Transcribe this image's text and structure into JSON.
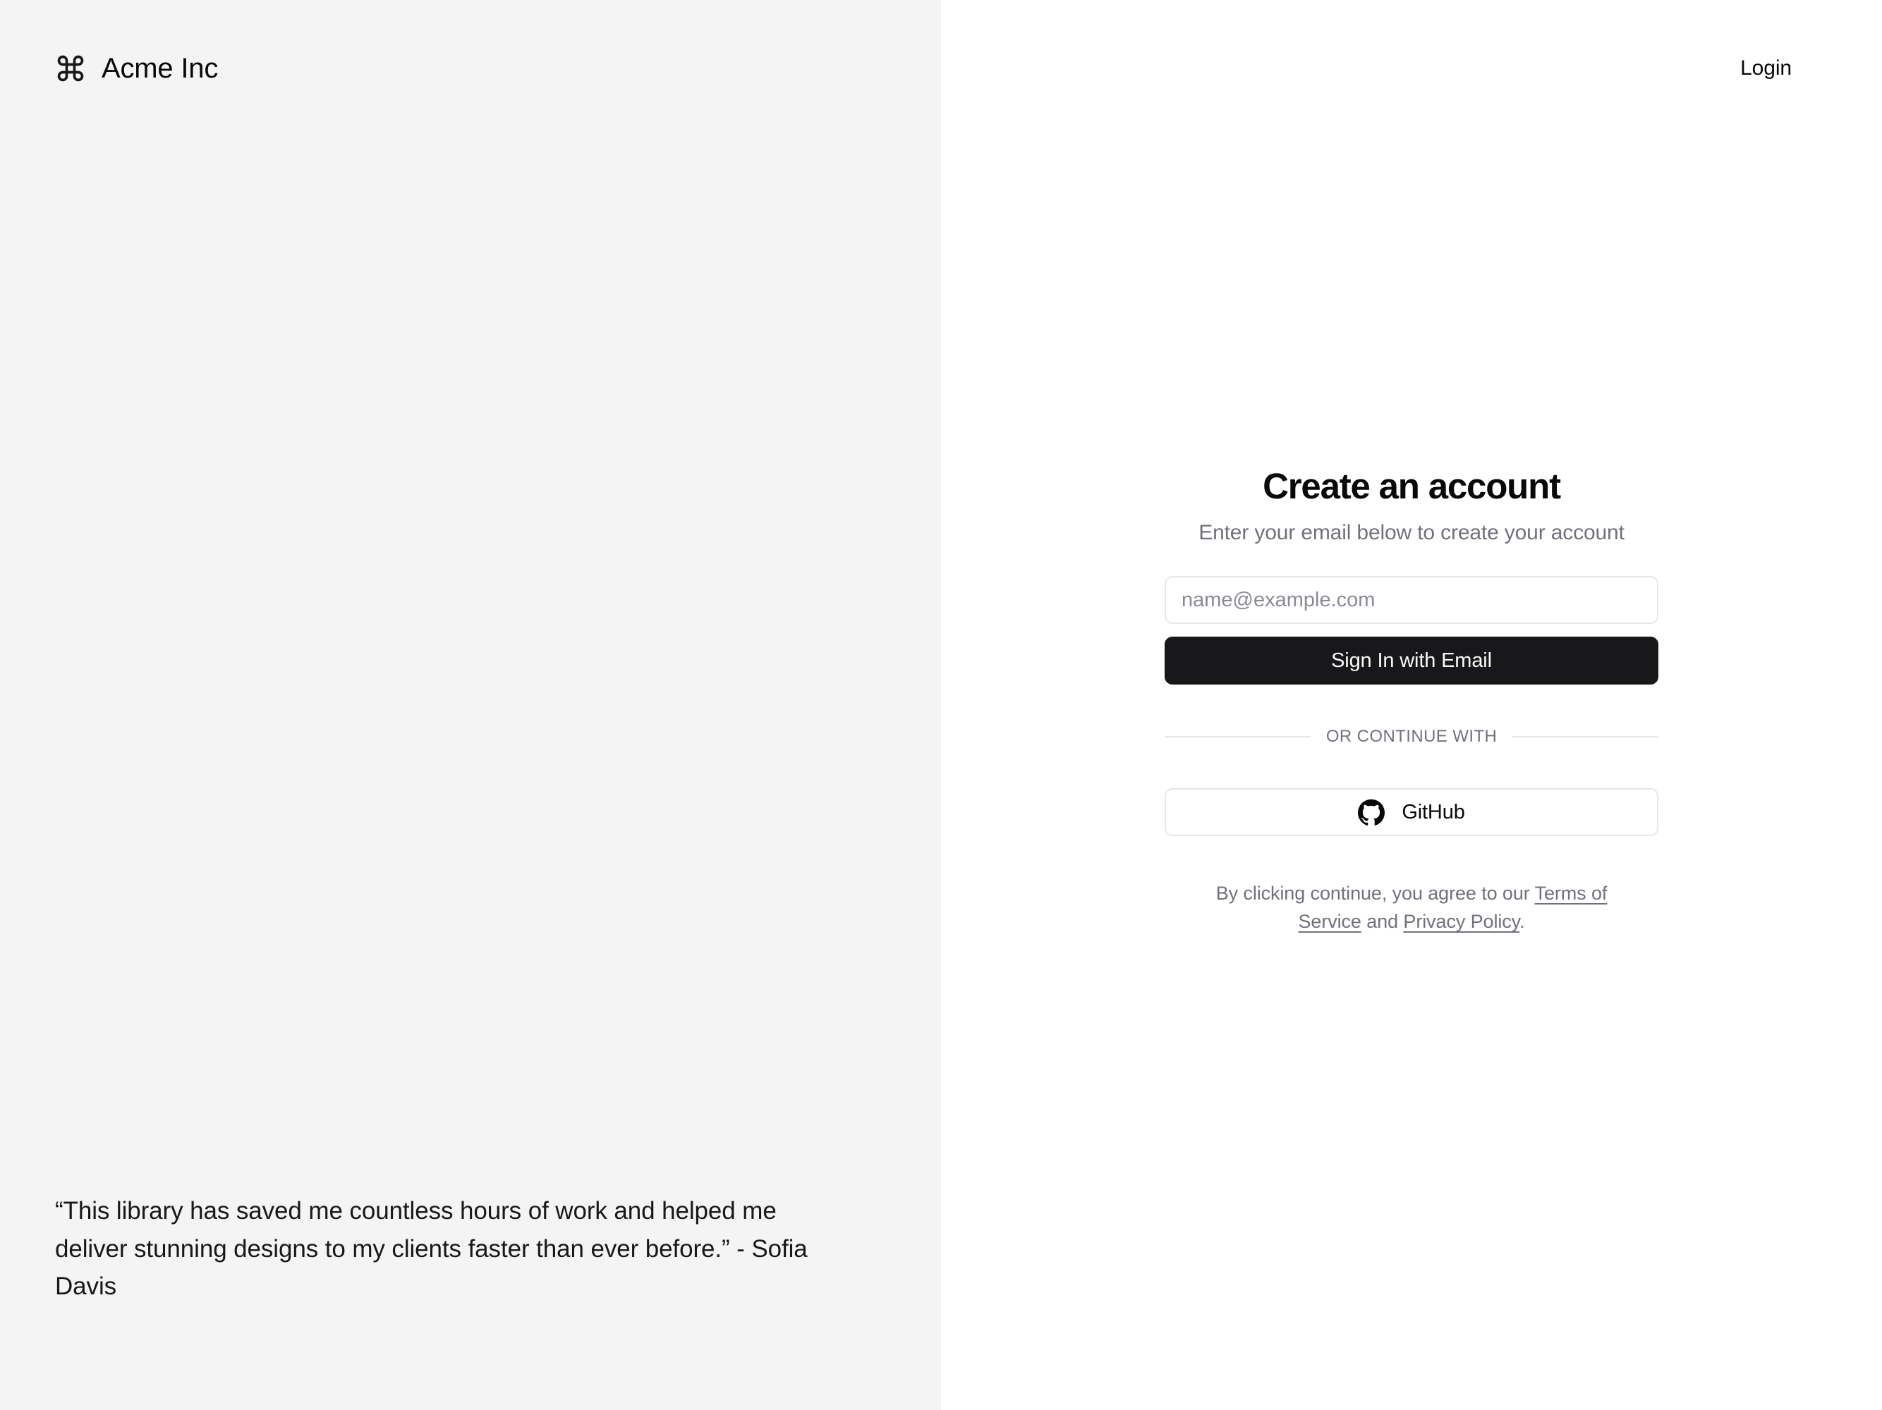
{
  "brand": {
    "icon": "command-icon",
    "name": "Acme Inc"
  },
  "header": {
    "login_label": "Login"
  },
  "auth": {
    "title": "Create an account",
    "subtitle": "Enter your email below to create your account",
    "email_placeholder": "name@example.com",
    "email_value": "",
    "submit_label": "Sign In with Email",
    "divider_label": "OR CONTINUE WITH",
    "oauth": {
      "icon": "github-icon",
      "label": "GitHub"
    },
    "terms": {
      "prefix": "By clicking continue, you agree to our ",
      "terms_link": "Terms of Service",
      "conjunction": " and ",
      "privacy_link": "Privacy Policy",
      "suffix": "."
    }
  },
  "testimonial": {
    "quote": "“This library has saved me countless hours of work and helped me deliver stunning designs to my clients faster than ever before.” - Sofia Davis"
  },
  "colors": {
    "left_panel_bg": "#f4f4f5",
    "right_panel_bg": "#ffffff",
    "primary": "#18181b",
    "primary_text": "#fafafa",
    "muted_text": "#71717a",
    "border": "#e7e7ea",
    "foreground": "#09090b"
  }
}
